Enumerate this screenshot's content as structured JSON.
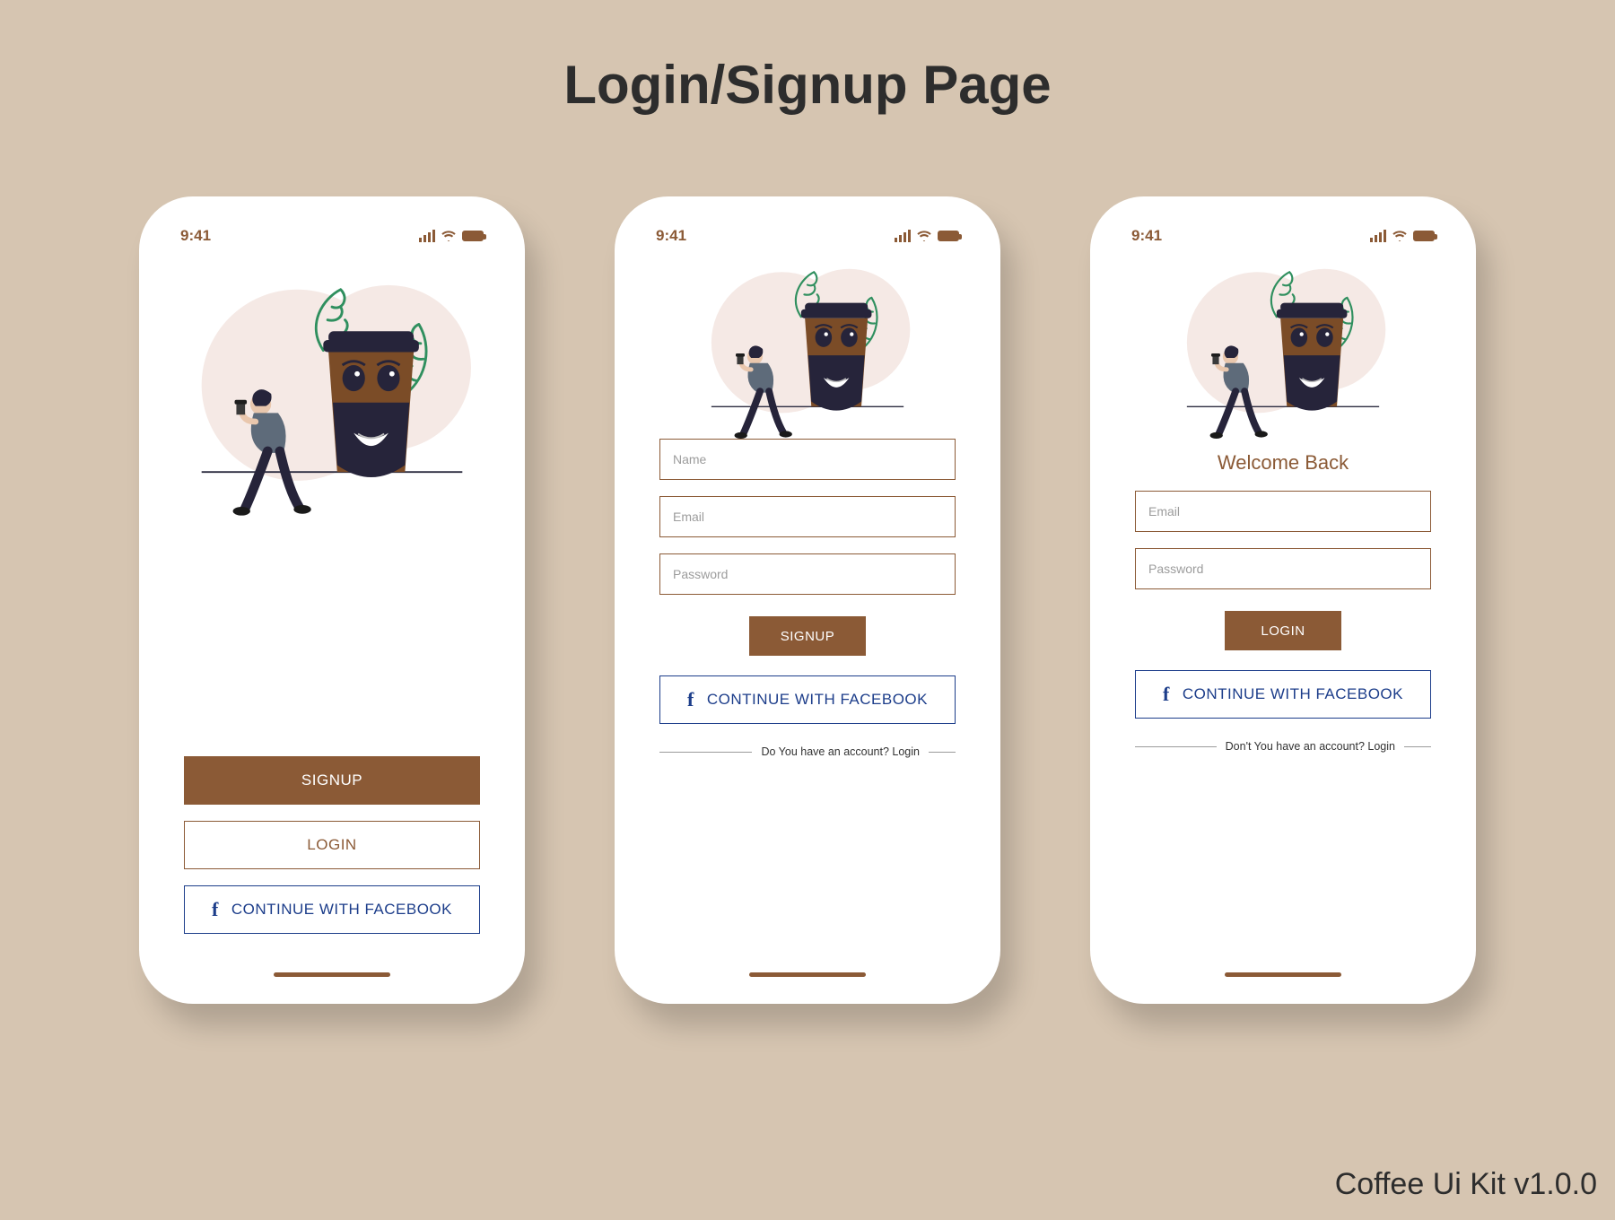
{
  "page": {
    "title": "Login/Signup Page"
  },
  "footer": {
    "brand": "Coffee Ui Kit v1.0.0"
  },
  "status": {
    "time": "9:41"
  },
  "colors": {
    "brand": "#8b5a36",
    "facebook": "#1c3d8a"
  },
  "screens": {
    "landing": {
      "signup_label": "SIGNUP",
      "login_label": "LOGIN",
      "facebook_label": "CONTINUE WITH FACEBOOK"
    },
    "signup": {
      "name_placeholder": "Name",
      "email_placeholder": "Email",
      "password_placeholder": "Password",
      "submit_label": "SIGNUP",
      "facebook_label": "CONTINUE WITH FACEBOOK",
      "footer_text": "Do You have an account? Login"
    },
    "login": {
      "heading": "Welcome Back",
      "email_placeholder": "Email",
      "password_placeholder": "Password",
      "submit_label": "LOGIN",
      "facebook_label": "CONTINUE WITH FACEBOOK",
      "footer_text": "Don't You have an account? Login"
    }
  }
}
